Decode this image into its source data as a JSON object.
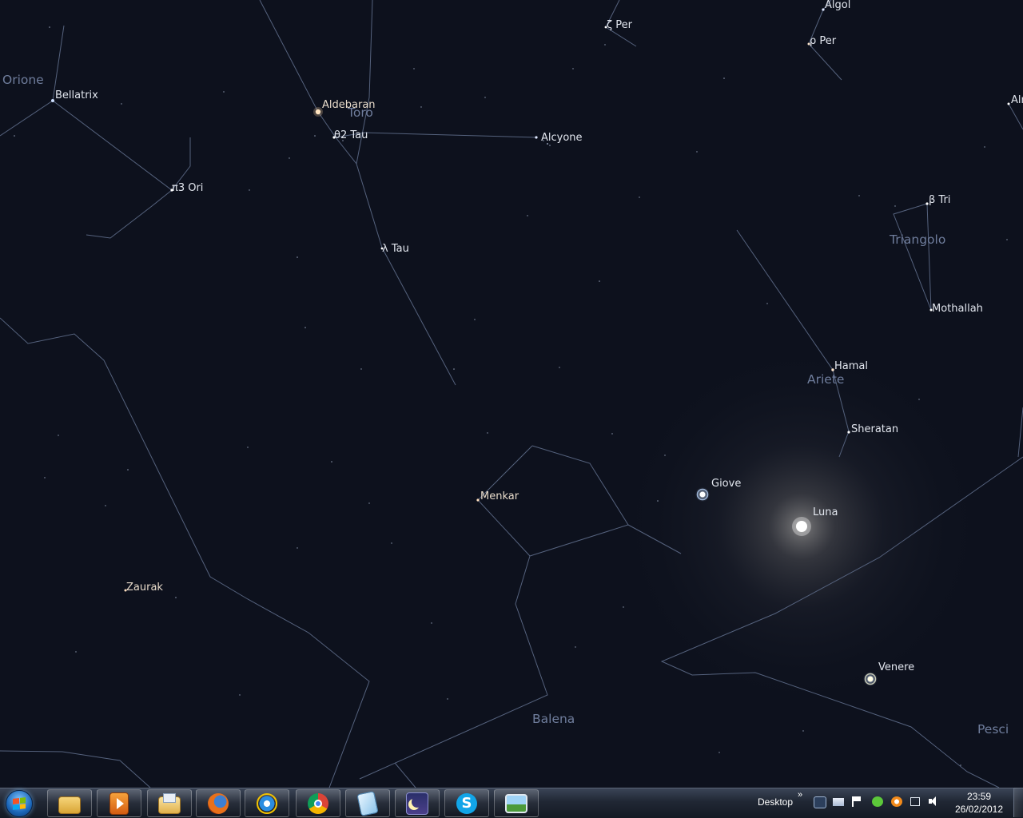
{
  "sky": {
    "constellations": [
      "Orione",
      "Toro",
      "Triangolo",
      "Ariete",
      "Balena",
      "Pesci"
    ],
    "stars": [
      "Bellatrix",
      "Aldebaran",
      "θ2 Tau",
      "Alcyone",
      "π3 Ori",
      "λ Tau",
      "ζ Per",
      "Algol",
      "ρ Per",
      "Alr",
      "β Tri",
      "Mothallah",
      "Hamal",
      "Sheratan",
      "Menkar",
      "Zaurak"
    ],
    "planets": [
      "Giove",
      "Luna",
      "Venere"
    ]
  },
  "taskbar": {
    "pinned_icons": [
      "windows-explorer-icon",
      "media-player-icon",
      "folder-files-icon",
      "firefox-icon",
      "internet-explorer-icon",
      "chrome-icon",
      "notes-icon",
      "stellarium-icon",
      "skype-icon",
      "photo-viewer-icon"
    ],
    "desktop_label": "Desktop",
    "overflow_label": "»",
    "tray_icons": [
      "camera-icon",
      "message-icon",
      "flag-icon",
      "green-app-icon",
      "avast-icon",
      "network-icon",
      "volume-icon"
    ],
    "time": "23:59",
    "date": "26/02/2012"
  },
  "colors": {
    "sky": "#0d111d",
    "constellation_line": "#55627d",
    "constellation_label": "#6f7d9c",
    "star_label": "#e2e6ee"
  }
}
